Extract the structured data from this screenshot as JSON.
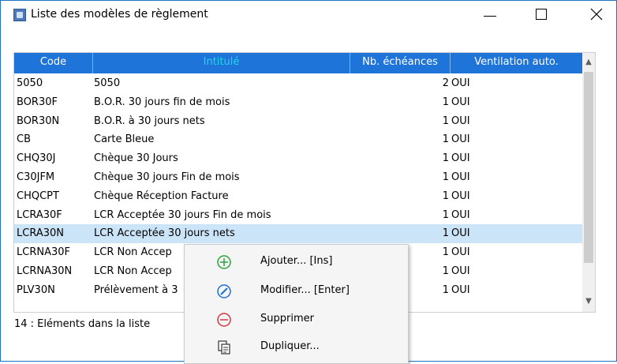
{
  "window": {
    "title": "Liste des modèles de règlement",
    "controls": {
      "minimize": "minimize-icon",
      "maximize": "maximize-icon",
      "close": "close-icon"
    }
  },
  "table": {
    "columns": [
      "Code",
      "Intitulé",
      "Nb. échéances",
      "Ventilation auto."
    ],
    "rows": [
      {
        "code": "5050",
        "intitule": "5050",
        "nb": "2",
        "vent": "OUI"
      },
      {
        "code": "BOR30F",
        "intitule": "B.O.R. 30 jours fin de mois",
        "nb": "1",
        "vent": "OUI"
      },
      {
        "code": "BOR30N",
        "intitule": "B.O.R. à 30 jours nets",
        "nb": "1",
        "vent": "OUI"
      },
      {
        "code": "CB",
        "intitule": "Carte Bleue",
        "nb": "1",
        "vent": "OUI"
      },
      {
        "code": "CHQ30J",
        "intitule": "Chèque 30 Jours",
        "nb": "1",
        "vent": "OUI"
      },
      {
        "code": "C30JFM",
        "intitule": "Chèque 30 jours Fin de  mois",
        "nb": "1",
        "vent": "OUI"
      },
      {
        "code": "CHQCPT",
        "intitule": "Chèque Réception Facture",
        "nb": "1",
        "vent": "OUI"
      },
      {
        "code": "LCRA30F",
        "intitule": "LCR Acceptée 30 jours Fin de mois",
        "nb": "1",
        "vent": "OUI"
      },
      {
        "code": "LCRA30N",
        "intitule": "LCR Acceptée 30 jours nets",
        "nb": "1",
        "vent": "OUI"
      },
      {
        "code": "LCRNA30F",
        "intitule": "LCR Non Accep",
        "nb": "1",
        "vent": "OUI"
      },
      {
        "code": "LCRNA30N",
        "intitule": "LCR Non Accep",
        "nb": "1",
        "vent": "OUI"
      },
      {
        "code": "PLV30N",
        "intitule": "Prélèvement à 3",
        "nb": "1",
        "vent": "OUI"
      }
    ],
    "selected_row": 8
  },
  "status": {
    "text": "14 : Eléments dans la liste"
  },
  "context_menu": {
    "items": [
      {
        "label": "Ajouter... [Ins]",
        "icon": "add-icon",
        "color": "#2aa33a"
      },
      {
        "label": "Modifier... [Enter]",
        "icon": "edit-icon",
        "color": "#1e6fcf"
      },
      {
        "label": "Supprimer",
        "icon": "delete-icon",
        "color": "#d9363e"
      },
      {
        "label": "Dupliquer...",
        "icon": "duplicate-icon",
        "color": "#333333"
      }
    ]
  },
  "colors": {
    "header_bg": "#1e74d8",
    "selection": "#cce4f7",
    "accent": "#1fd9e8"
  }
}
